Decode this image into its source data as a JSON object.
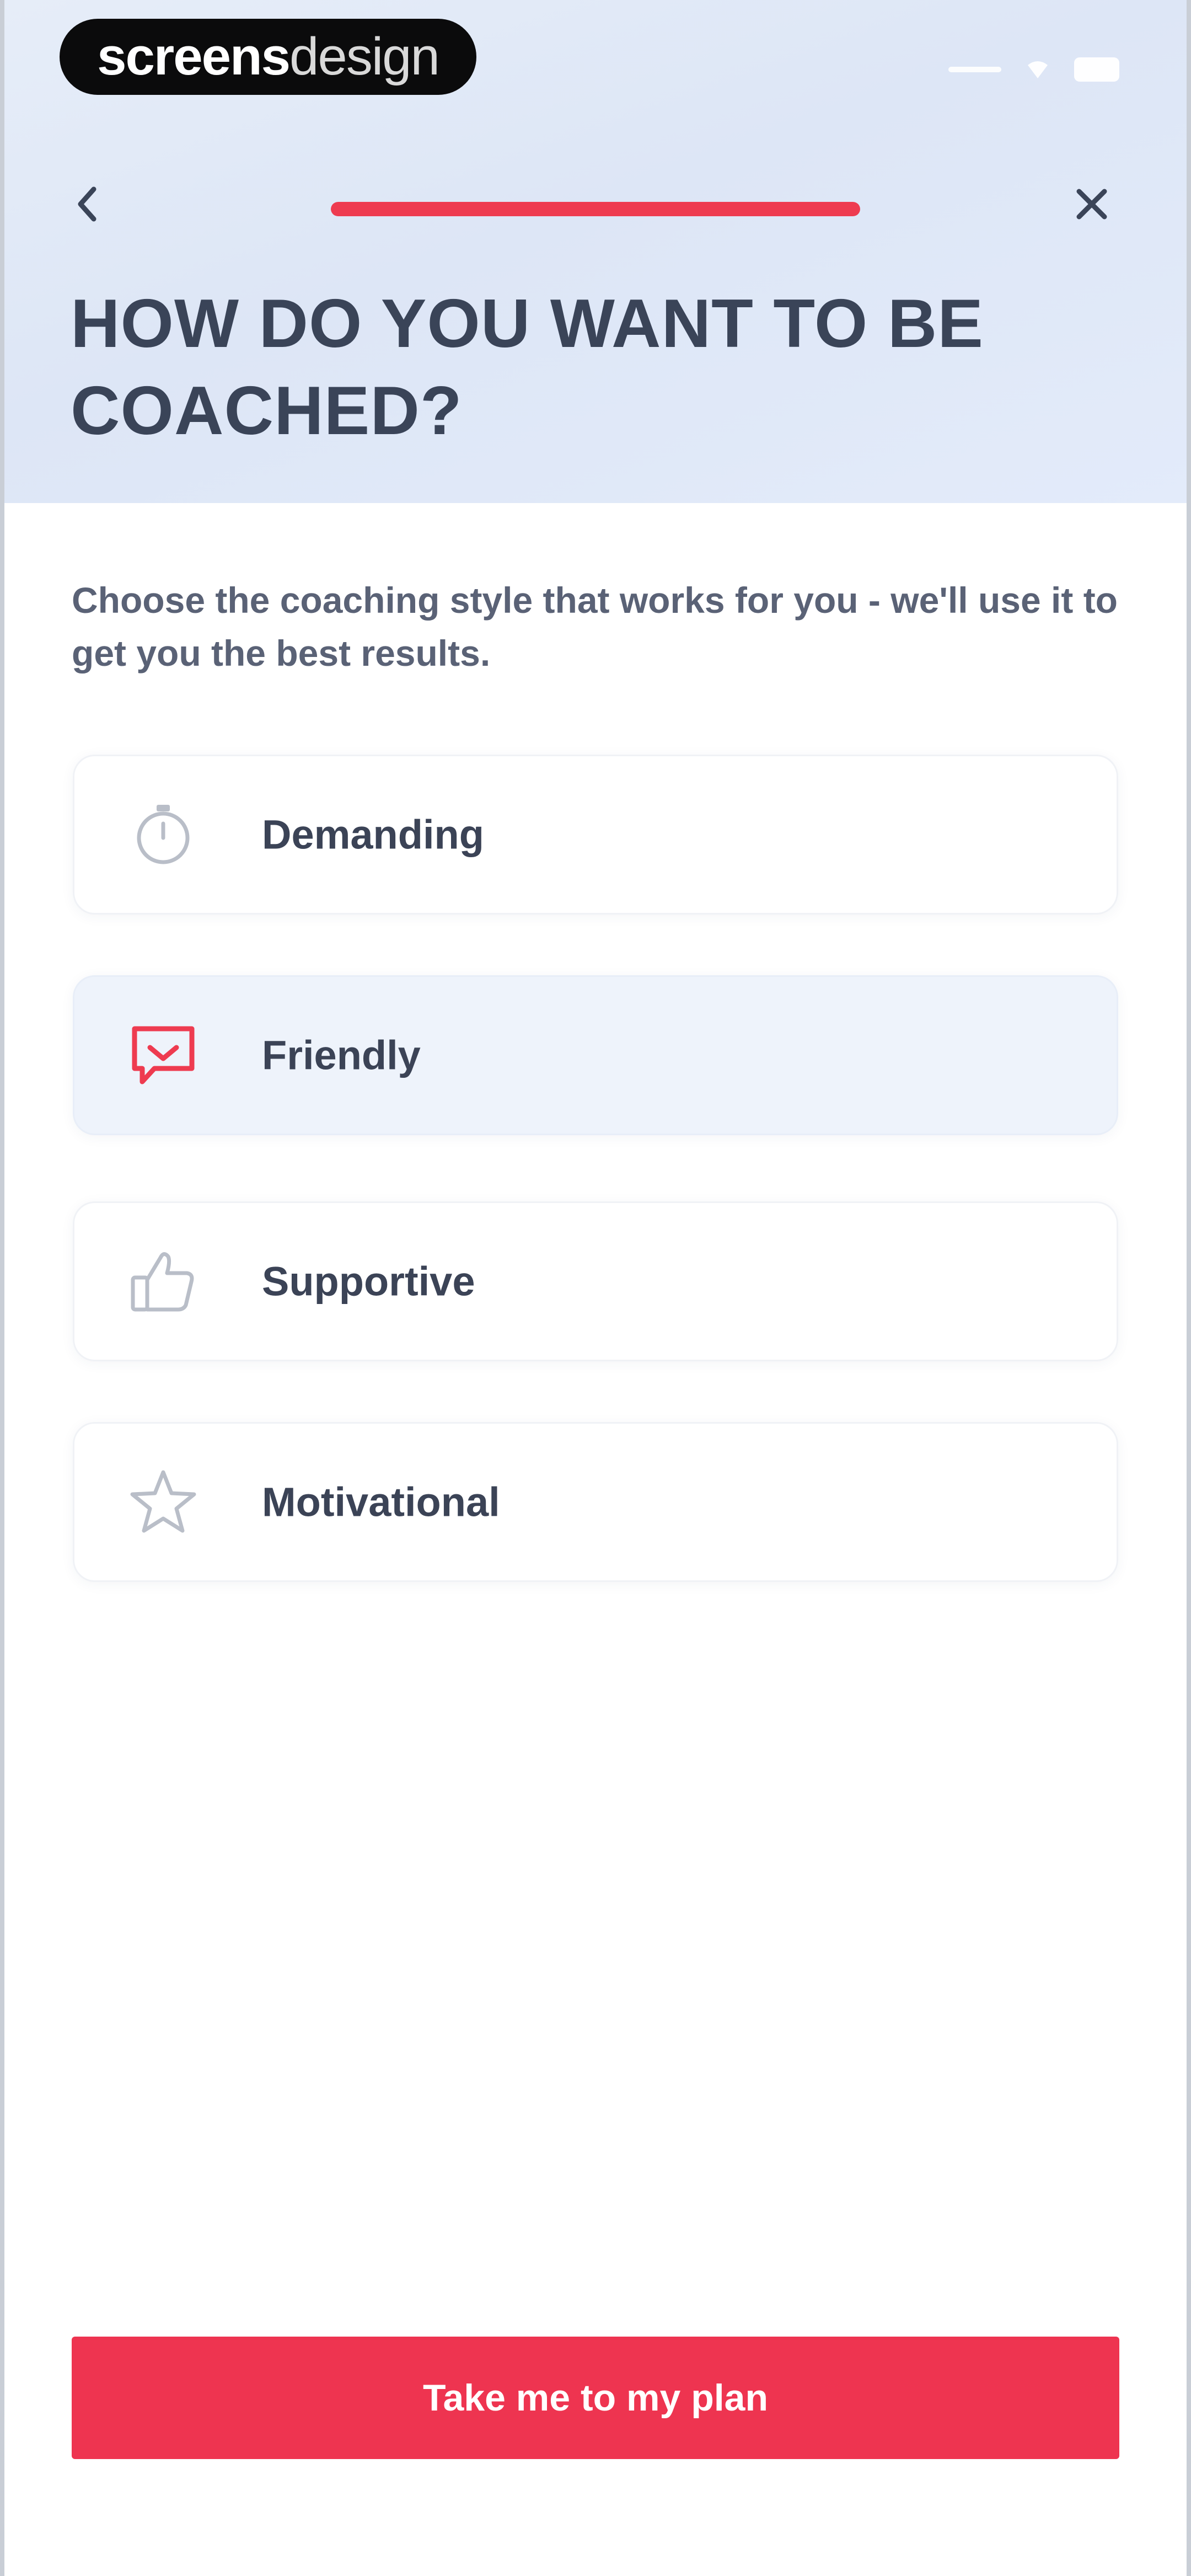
{
  "status_bar": {
    "brand_part1": "screens",
    "brand_part2": "design"
  },
  "nav": {
    "back_icon": "chevron-left-icon",
    "close_icon": "close-icon",
    "progress": 1.0,
    "progress_color": "#ee3b50"
  },
  "title": "HOW DO YOU WANT TO BE COACHED?",
  "subtitle": "Choose the coaching style that works for you - we'll use it to get you the best results.",
  "options": [
    {
      "label": "Demanding",
      "icon": "stopwatch-icon",
      "selected": false
    },
    {
      "label": "Friendly",
      "icon": "chat-heart-icon",
      "selected": true
    },
    {
      "label": "Supportive",
      "icon": "thumbs-up-icon",
      "selected": false
    },
    {
      "label": "Motivational",
      "icon": "star-icon",
      "selected": false
    }
  ],
  "cta": {
    "label": "Take me to my plan",
    "color": "#ee3450"
  }
}
